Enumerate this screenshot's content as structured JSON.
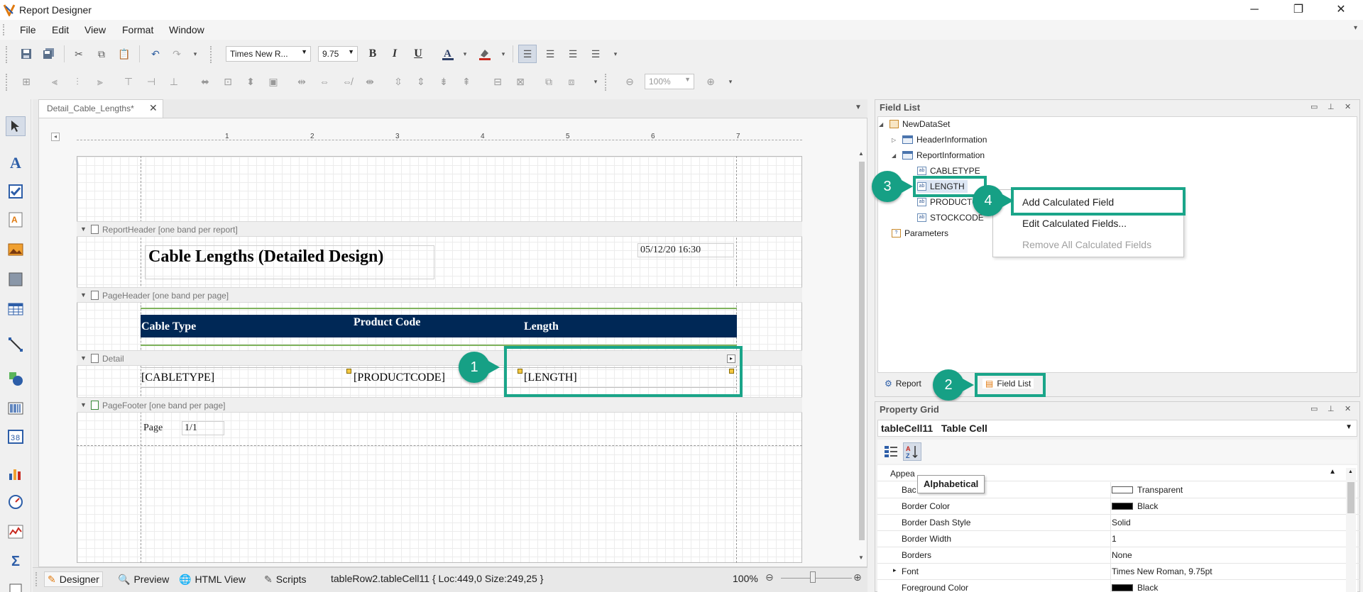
{
  "window": {
    "title": "Report Designer",
    "controls": {
      "minimize": "─",
      "restore": "❐",
      "close": "✕"
    }
  },
  "menu": [
    "File",
    "Edit",
    "View",
    "Format",
    "Window"
  ],
  "toolbar": {
    "font_family": "Times New R...",
    "font_size": "9.75",
    "bold": "B",
    "italic": "I",
    "underline": "U",
    "zoom": "100%"
  },
  "document": {
    "tab_label": "Detail_Cable_Lengths*",
    "ruler_marks": [
      "1",
      "2",
      "3",
      "4",
      "5",
      "6",
      "7"
    ],
    "bands": {
      "report_header": "ReportHeader [one band per report]",
      "page_header": "PageHeader [one band per page]",
      "detail": "Detail",
      "page_footer": "PageFooter [one band per page]"
    },
    "report_title": "Cable Lengths (Detailed Design)",
    "report_date": "05/12/20 16:30",
    "headers": [
      "Cable Type",
      "Product Code",
      "Length"
    ],
    "detail_cells": [
      "[CABLETYPE]",
      "[PRODUCTCODE]",
      "[LENGTH]"
    ],
    "footer_page_label": "Page",
    "footer_page_num": "1/1"
  },
  "status_bar": {
    "tabs": [
      "Designer",
      "Preview",
      "HTML View",
      "Scripts"
    ],
    "info": "tableRow2.tableCell11 { Loc:449,0 Size:249,25 }",
    "zoom": "100%"
  },
  "field_list": {
    "title": "Field List",
    "tree": {
      "root": "NewDataSet",
      "tables": [
        "HeaderInformation",
        "ReportInformation"
      ],
      "fields": [
        "CABLETYPE",
        "LENGTH",
        "PRODUCTC",
        "STOCKCODE"
      ],
      "parameters": "Parameters"
    },
    "context_menu": [
      "Add Calculated Field",
      "Edit Calculated Fields...",
      "Remove All Calculated Fields"
    ],
    "bottom_tabs": [
      "Report",
      "Field List"
    ]
  },
  "callouts": [
    "1",
    "2",
    "3",
    "4"
  ],
  "property_grid": {
    "title": "Property Grid",
    "selected_name": "tableCell11",
    "selected_type": "Table Cell",
    "tooltip": "Alphabetical",
    "category": "Appea",
    "rows": [
      {
        "name": "Bac",
        "value": "Transparent",
        "swatch": "#ffffff"
      },
      {
        "name": "Border Color",
        "value": "Black",
        "swatch": "#000000"
      },
      {
        "name": "Border Dash Style",
        "value": "Solid"
      },
      {
        "name": "Border Width",
        "value": "1"
      },
      {
        "name": "Borders",
        "value": "None"
      },
      {
        "name": "Font",
        "value": "Times New Roman, 9.75pt"
      },
      {
        "name": "Foreground Color",
        "value": "Black",
        "swatch": "#000000"
      }
    ]
  },
  "colors": {
    "accent_callout": "#16a085",
    "header_bar": "#002856",
    "header_rule": "#7fb35c"
  }
}
